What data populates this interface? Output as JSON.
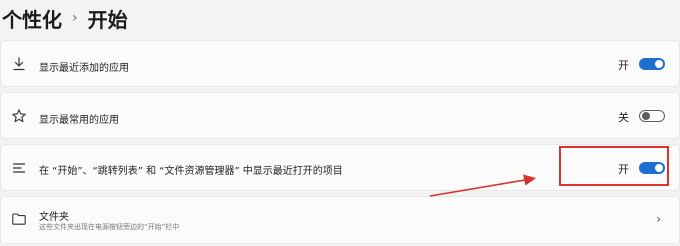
{
  "breadcrumb": {
    "parent": "个性化",
    "separator": "›",
    "current": "开始"
  },
  "settings": [
    {
      "icon": "download-icon",
      "label": "显示最近添加的应用",
      "status": "开",
      "toggle_on": true
    },
    {
      "icon": "star-icon",
      "label": "显示最常用的应用",
      "status": "关",
      "toggle_on": false
    },
    {
      "icon": "list-icon",
      "label": "在 “开始”、“跳转列表” 和 “文件资源管理器” 中显示最近打开的项目",
      "status": "开",
      "toggle_on": true
    }
  ],
  "folders": {
    "icon": "folder-icon",
    "label": "文件夹",
    "description": "这些文件夹出现在电源按钮旁边的“开始”栏中"
  },
  "annotation": {
    "color": "#d9322f"
  },
  "colors": {
    "accent": "#1e6fd1",
    "background": "#f3f3f3",
    "card": "#fbfbfb"
  }
}
